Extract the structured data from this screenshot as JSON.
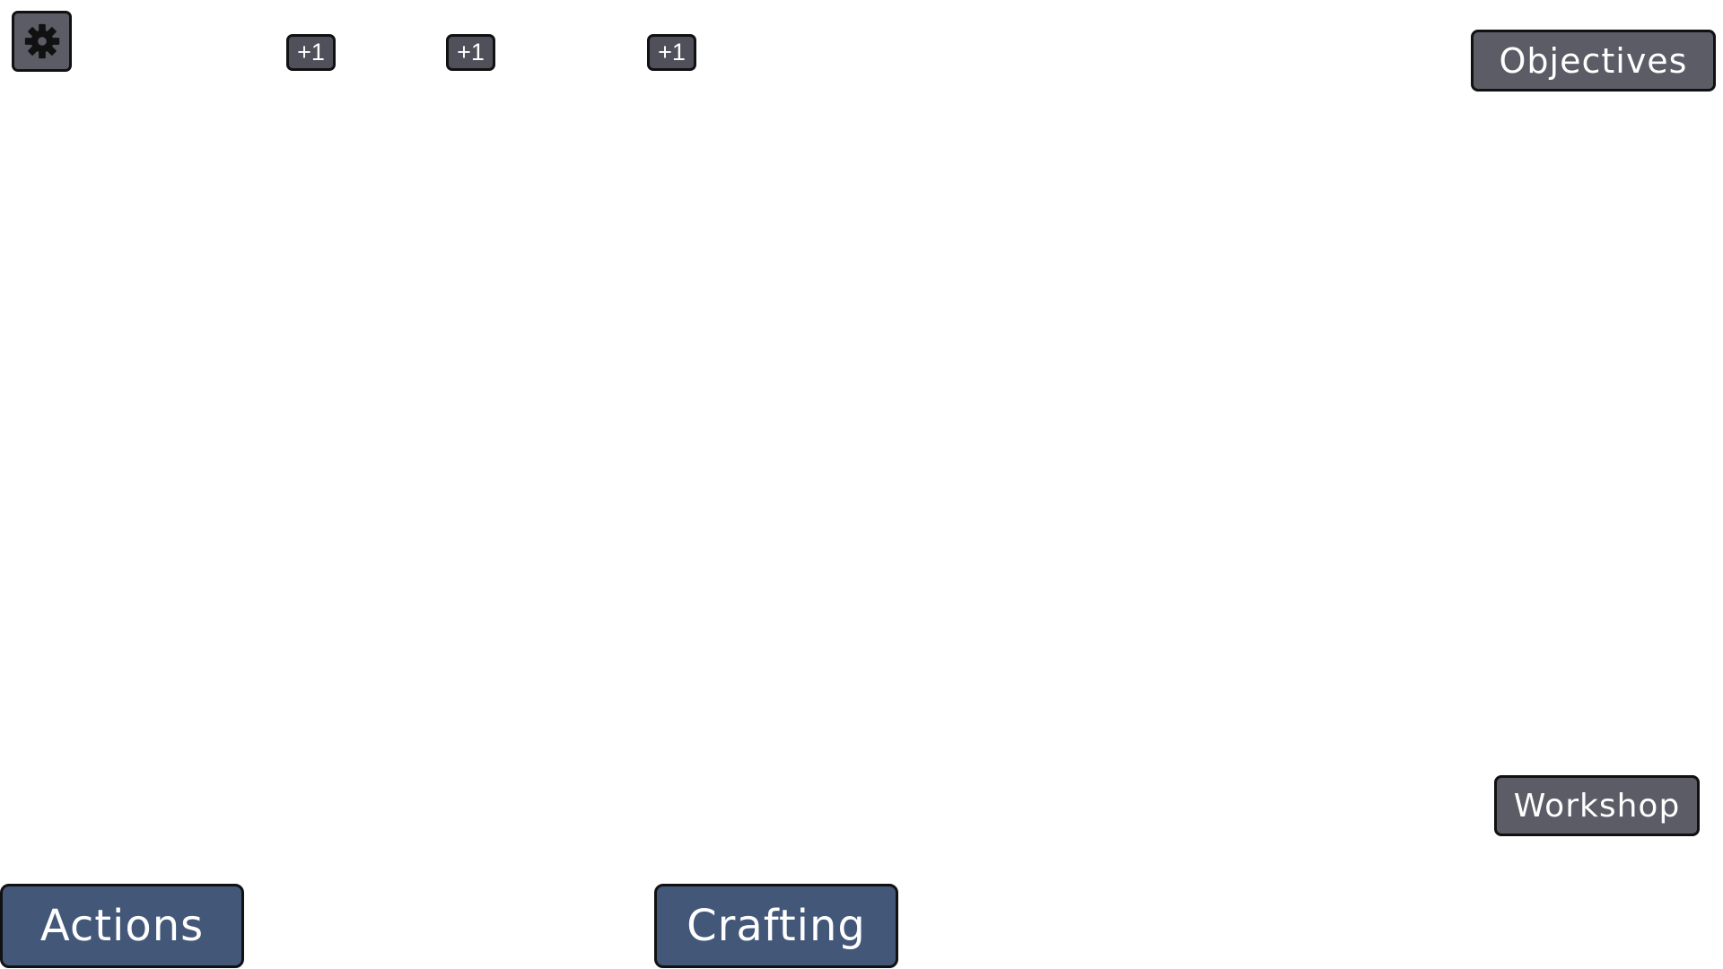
{
  "hud": {
    "settings": {
      "icon": "gear-icon"
    },
    "plus_badges": [
      {
        "label": "+1"
      },
      {
        "label": "+1"
      },
      {
        "label": "+1"
      }
    ],
    "objectives_label": "Objectives",
    "workshop_label": "Workshop",
    "actions_label": "Actions",
    "crafting_label": "Crafting"
  },
  "colors": {
    "gray_button": "#5b5c66",
    "blue_button": "#435779",
    "border": "#111111",
    "text": "#ffffff"
  }
}
